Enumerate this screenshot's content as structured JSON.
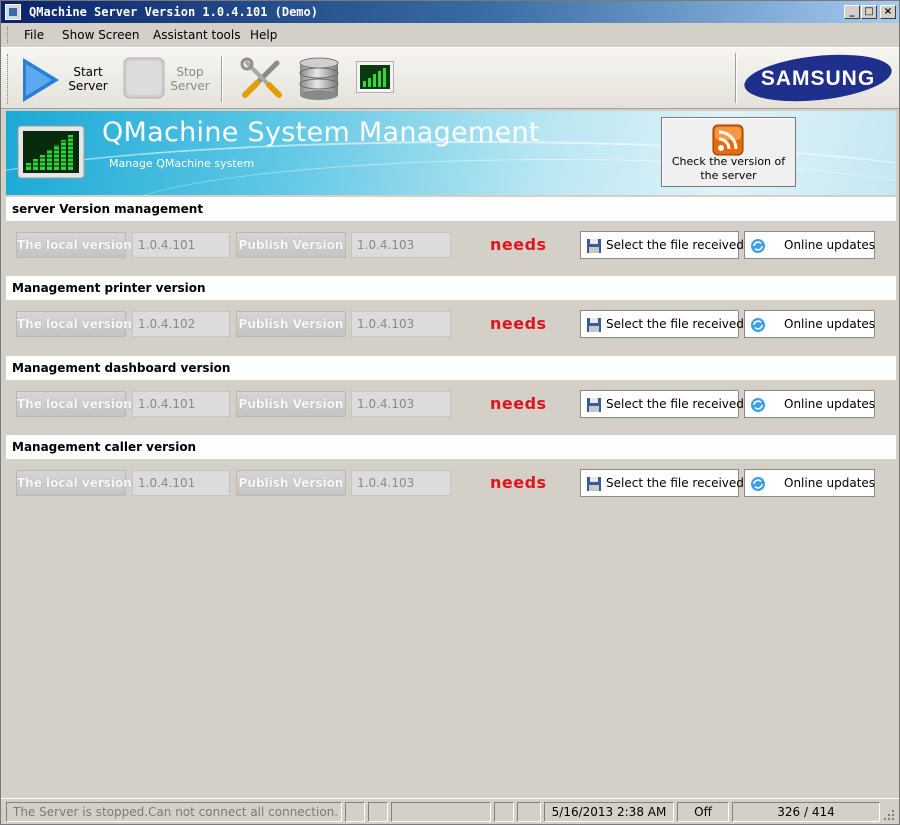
{
  "window": {
    "title": "QMachine Server Version 1.0.4.101 (Demo)",
    "controls": {
      "minimize": "_",
      "maximize": "□",
      "close": "×"
    }
  },
  "menu": [
    "File",
    "Show Screen",
    "Assistant tools",
    "Help"
  ],
  "toolbar": {
    "start_label": "Start\nServer",
    "stop_label": "Stop\nServer",
    "brand": "SAMSUNG"
  },
  "banner": {
    "title": "QMachine System Management",
    "subtitle": "Manage QMachine system",
    "check_button_label": "Check the version of\nthe server"
  },
  "sections": [
    {
      "title": "server Version management",
      "local_label": "The local version",
      "local_value": "1.0.4.101",
      "publish_label": "Publish Version",
      "publish_value": "1.0.4.103",
      "status": "needs",
      "select_label": "Select the file received",
      "online_label": "Online updates"
    },
    {
      "title": "Management printer version",
      "local_label": "The local version",
      "local_value": "1.0.4.102",
      "publish_label": "Publish Version",
      "publish_value": "1.0.4.103",
      "status": "needs",
      "select_label": "Select the file received",
      "online_label": "Online updates"
    },
    {
      "title": "Management dashboard version",
      "local_label": "The local version",
      "local_value": "1.0.4.101",
      "publish_label": "Publish Version",
      "publish_value": "1.0.4.103",
      "status": "needs",
      "select_label": "Select the file received",
      "online_label": "Online updates"
    },
    {
      "title": "Management caller version",
      "local_label": "The local version",
      "local_value": "1.0.4.101",
      "publish_label": "Publish Version",
      "publish_value": "1.0.4.103",
      "status": "needs",
      "select_label": "Select the file received",
      "online_label": "Online updates"
    }
  ],
  "status": {
    "message": "The Server is stopped.Can not connect all connection.",
    "datetime": "5/16/2013 2:38 AM",
    "state": "Off",
    "count": "326 / 414"
  },
  "colors": {
    "needs": "#e0141e",
    "banner": "#1aa9d6",
    "brand": "#1e2f8c"
  }
}
